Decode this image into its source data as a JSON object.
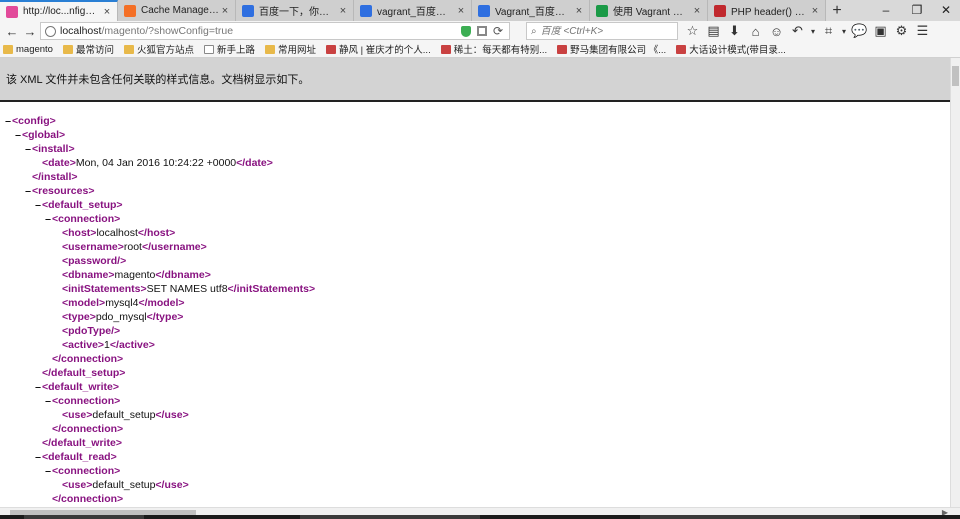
{
  "tabs": [
    {
      "label": "http://loc...nfig=true",
      "icon": "firefox-icon",
      "color": "#e24a9a",
      "active": true
    },
    {
      "label": "Cache Management...",
      "icon": "magento-icon",
      "color": "#f46f25"
    },
    {
      "label": "百度一下，你就知道",
      "icon": "baidu-paw-icon",
      "color": "#2f6fe0"
    },
    {
      "label": "vagrant_百度搜索",
      "icon": "baidu-paw-icon",
      "color": "#2f6fe0"
    },
    {
      "label": "Vagrant_百度百科",
      "icon": "baidu-paw-icon",
      "color": "#2f6fe0"
    },
    {
      "label": "使用 Vagrant 打造跨...",
      "icon": "sf-icon",
      "color": "#1b9a47"
    },
    {
      "label": "PHP header() 函数",
      "icon": "w3school-icon",
      "color": "#c0282d"
    }
  ],
  "toolbar": {
    "url_host": "localhost",
    "url_path": "/magento/?showConfig=true",
    "search_placeholder": "百度 <Ctrl+K>"
  },
  "bookmarks": [
    {
      "label": "magento",
      "icon": "folder-icon"
    },
    {
      "label": "最常访问",
      "icon": "folder-icon"
    },
    {
      "label": "火狐官方站点",
      "icon": "folder-icon"
    },
    {
      "label": "新手上路",
      "icon": "page-icon"
    },
    {
      "label": "常用网址",
      "icon": "folder-icon"
    },
    {
      "label": "静风 | 崔庆才的个人...",
      "icon": "site-icon"
    },
    {
      "label": "稀土：每天都有特别...",
      "icon": "site-icon"
    },
    {
      "label": "野马集团有限公司 《...",
      "icon": "site-icon"
    },
    {
      "label": "大话设计模式(带目录...",
      "icon": "site-icon"
    }
  ],
  "banner": {
    "text": "该 XML 文件并未包含任何关联的样式信息。文档树显示如下。"
  },
  "xml_lines": [
    {
      "depth": 0,
      "toggle": "–",
      "parts": [
        [
          "tag",
          "<config>"
        ]
      ]
    },
    {
      "depth": 1,
      "toggle": "–",
      "parts": [
        [
          "tag",
          "<global>"
        ]
      ]
    },
    {
      "depth": 2,
      "toggle": "–",
      "parts": [
        [
          "tag",
          "<install>"
        ]
      ]
    },
    {
      "depth": 3,
      "toggle": "",
      "parts": [
        [
          "tag",
          "<date>"
        ],
        [
          "txt",
          "Mon, 04 Jan 2016 10:24:22 +0000"
        ],
        [
          "tag",
          "</date>"
        ]
      ]
    },
    {
      "depth": 2,
      "toggle": "",
      "parts": [
        [
          "tag",
          "</install>"
        ]
      ]
    },
    {
      "depth": 2,
      "toggle": "–",
      "parts": [
        [
          "tag",
          "<resources>"
        ]
      ]
    },
    {
      "depth": 3,
      "toggle": "–",
      "parts": [
        [
          "tag",
          "<default_setup>"
        ]
      ]
    },
    {
      "depth": 4,
      "toggle": "–",
      "parts": [
        [
          "tag",
          "<connection>"
        ]
      ]
    },
    {
      "depth": 5,
      "toggle": "",
      "parts": [
        [
          "tag",
          "<host>"
        ],
        [
          "txt",
          "localhost"
        ],
        [
          "tag",
          "</host>"
        ]
      ]
    },
    {
      "depth": 5,
      "toggle": "",
      "parts": [
        [
          "tag",
          "<username>"
        ],
        [
          "txt",
          "root"
        ],
        [
          "tag",
          "</username>"
        ]
      ]
    },
    {
      "depth": 5,
      "toggle": "",
      "parts": [
        [
          "tag",
          "<password/>"
        ]
      ]
    },
    {
      "depth": 5,
      "toggle": "",
      "parts": [
        [
          "tag",
          "<dbname>"
        ],
        [
          "txt",
          "magento"
        ],
        [
          "tag",
          "</dbname>"
        ]
      ]
    },
    {
      "depth": 5,
      "toggle": "",
      "parts": [
        [
          "tag",
          "<initStatements>"
        ],
        [
          "txt",
          "SET NAMES utf8"
        ],
        [
          "tag",
          "</initStatements>"
        ]
      ]
    },
    {
      "depth": 5,
      "toggle": "",
      "parts": [
        [
          "tag",
          "<model>"
        ],
        [
          "txt",
          "mysql4"
        ],
        [
          "tag",
          "</model>"
        ]
      ]
    },
    {
      "depth": 5,
      "toggle": "",
      "parts": [
        [
          "tag",
          "<type>"
        ],
        [
          "txt",
          "pdo_mysql"
        ],
        [
          "tag",
          "</type>"
        ]
      ]
    },
    {
      "depth": 5,
      "toggle": "",
      "parts": [
        [
          "tag",
          "<pdoType/>"
        ]
      ]
    },
    {
      "depth": 5,
      "toggle": "",
      "parts": [
        [
          "tag",
          "<active>"
        ],
        [
          "txt",
          "1"
        ],
        [
          "tag",
          "</active>"
        ]
      ]
    },
    {
      "depth": 4,
      "toggle": "",
      "parts": [
        [
          "tag",
          "</connection>"
        ]
      ]
    },
    {
      "depth": 3,
      "toggle": "",
      "parts": [
        [
          "tag",
          "</default_setup>"
        ]
      ]
    },
    {
      "depth": 3,
      "toggle": "–",
      "parts": [
        [
          "tag",
          "<default_write>"
        ]
      ]
    },
    {
      "depth": 4,
      "toggle": "–",
      "parts": [
        [
          "tag",
          "<connection>"
        ]
      ]
    },
    {
      "depth": 5,
      "toggle": "",
      "parts": [
        [
          "tag",
          "<use>"
        ],
        [
          "txt",
          "default_setup"
        ],
        [
          "tag",
          "</use>"
        ]
      ]
    },
    {
      "depth": 4,
      "toggle": "",
      "parts": [
        [
          "tag",
          "</connection>"
        ]
      ]
    },
    {
      "depth": 3,
      "toggle": "",
      "parts": [
        [
          "tag",
          "</default_write>"
        ]
      ]
    },
    {
      "depth": 3,
      "toggle": "–",
      "parts": [
        [
          "tag",
          "<default_read>"
        ]
      ]
    },
    {
      "depth": 4,
      "toggle": "–",
      "parts": [
        [
          "tag",
          "<connection>"
        ]
      ]
    },
    {
      "depth": 5,
      "toggle": "",
      "parts": [
        [
          "tag",
          "<use>"
        ],
        [
          "txt",
          "default_setup"
        ],
        [
          "tag",
          "</use>"
        ]
      ]
    },
    {
      "depth": 4,
      "toggle": "",
      "parts": [
        [
          "tag",
          "</connection>"
        ]
      ]
    }
  ]
}
